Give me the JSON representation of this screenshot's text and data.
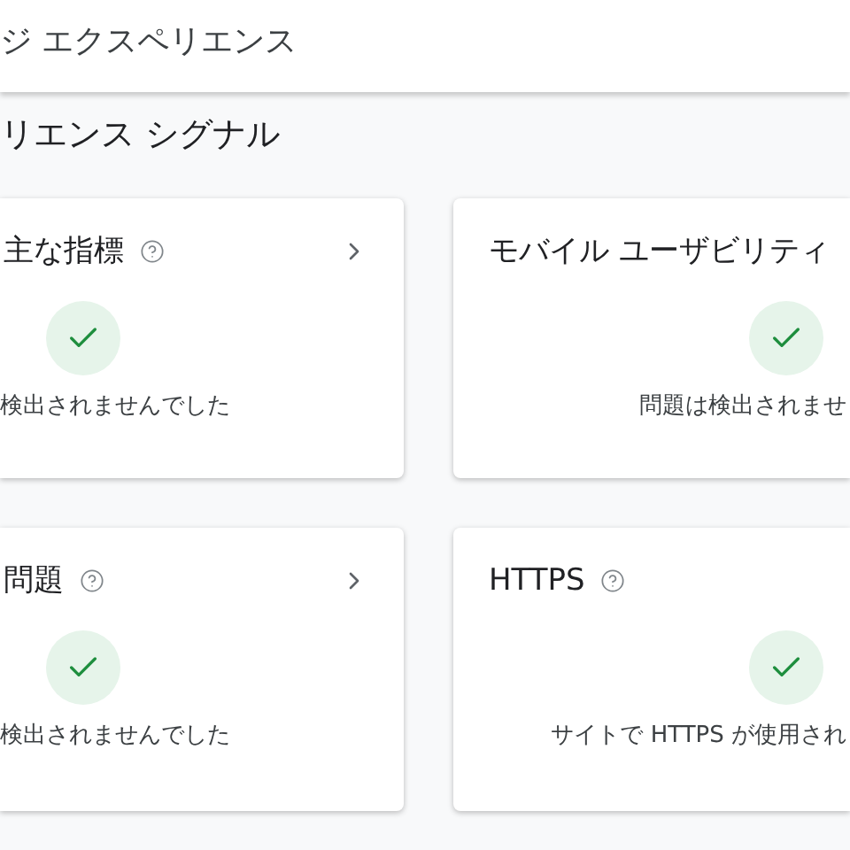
{
  "header": {
    "title": "ジ エクスペリエンス"
  },
  "section": {
    "title": "リエンス シグナル"
  },
  "cards": [
    {
      "title": "主な指標",
      "help": true,
      "chevron": true,
      "status": "検出されませんでした"
    },
    {
      "title": "モバイル ユーザビリティ",
      "help": false,
      "chevron": false,
      "status": "問題は検出されませ"
    },
    {
      "title": "問題",
      "help": true,
      "chevron": true,
      "status": "検出されませんでした"
    },
    {
      "title": "HTTPS",
      "help": true,
      "chevron": false,
      "status": "サイトで HTTPS が使用され"
    }
  ]
}
